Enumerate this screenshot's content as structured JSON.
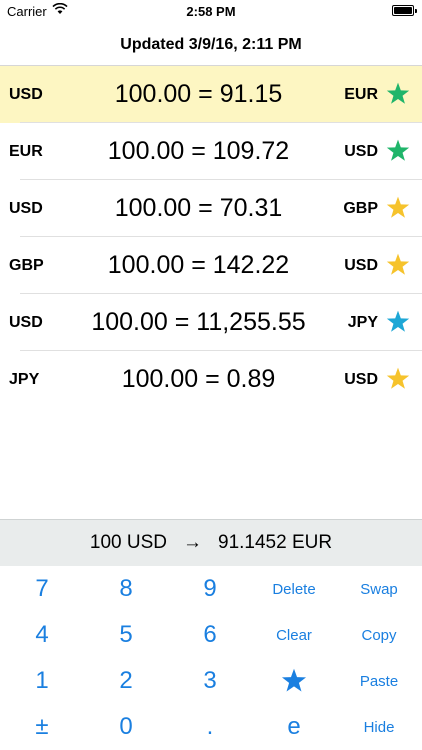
{
  "status_bar": {
    "carrier": "Carrier",
    "time": "2:58 PM"
  },
  "header": {
    "title": "Updated 3/9/16, 2:11 PM"
  },
  "rates": [
    {
      "from": "USD",
      "conversion": "100.00 = 91.15",
      "to": "EUR",
      "star_color": "#1fb56a"
    },
    {
      "from": "EUR",
      "conversion": "100.00 = 109.72",
      "to": "USD",
      "star_color": "#1fb56a"
    },
    {
      "from": "USD",
      "conversion": "100.00 = 70.31",
      "to": "GBP",
      "star_color": "#f6c32c"
    },
    {
      "from": "GBP",
      "conversion": "100.00 = 142.22",
      "to": "USD",
      "star_color": "#f6c32c"
    },
    {
      "from": "USD",
      "conversion": "100.00 = 11,255.55",
      "to": "JPY",
      "star_color": "#1ea7d6"
    },
    {
      "from": "JPY",
      "conversion": "100.00 = 0.89",
      "to": "USD",
      "star_color": "#f6c32c"
    }
  ],
  "result": {
    "input": "100 USD",
    "arrow": "→",
    "output": "91.1452 EUR"
  },
  "keypad": {
    "k7": "7",
    "k8": "8",
    "k9": "9",
    "delete": "Delete",
    "swap": "Swap",
    "k4": "4",
    "k5": "5",
    "k6": "6",
    "clear": "Clear",
    "copy": "Copy",
    "k1": "1",
    "k2": "2",
    "k3": "3",
    "paste": "Paste",
    "plusminus": "±",
    "k0": "0",
    "dot": ".",
    "e": "e",
    "hide": "Hide"
  },
  "colors": {
    "accent": "#1a7fe0",
    "highlight": "#fdf6c2"
  },
  "icons": {
    "favorite": "star-icon",
    "wifi": "wifi-icon",
    "battery": "battery-icon"
  }
}
